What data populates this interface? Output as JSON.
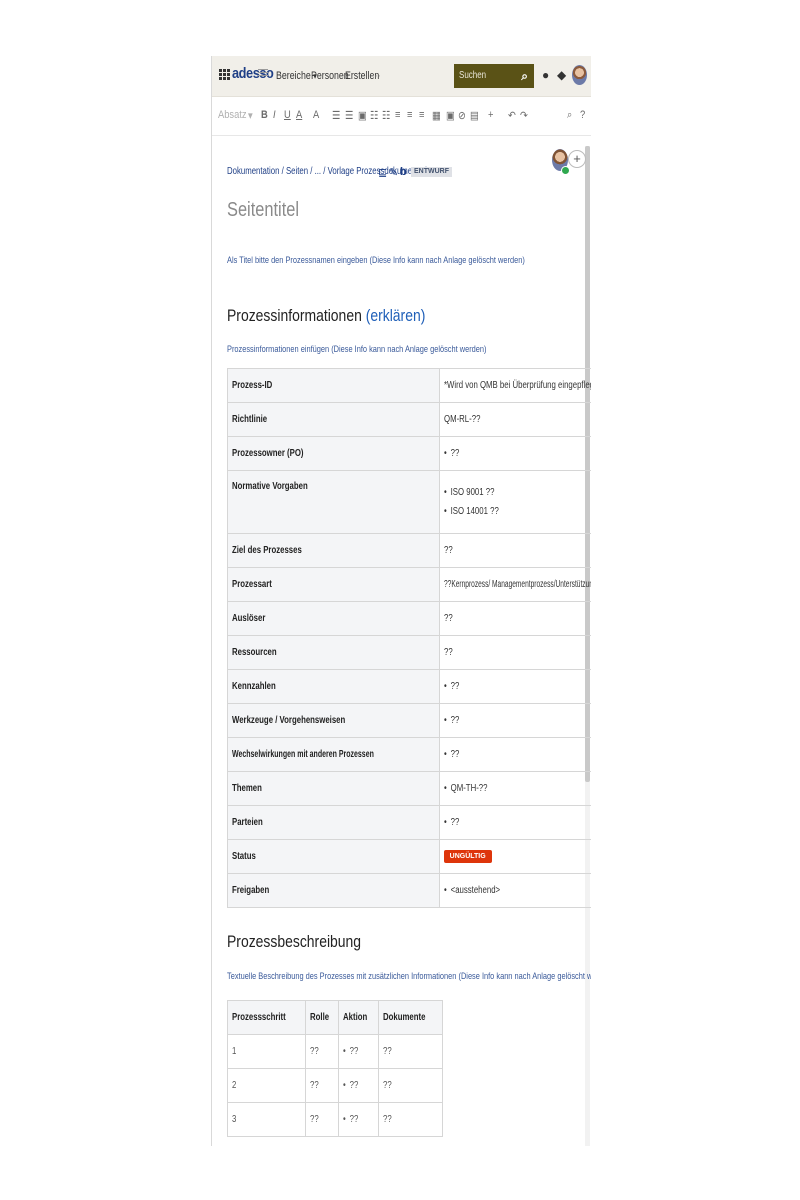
{
  "topbar": {
    "logo": "adesso",
    "nav": [
      {
        "label": "Bereiche",
        "chevron": "chevron-down-icon"
      },
      {
        "label": "Personen"
      },
      {
        "label": "Erstellen"
      },
      {
        "label": "···"
      }
    ],
    "search_placeholder": "Suchen",
    "icons": [
      "search-icon",
      "help-icon",
      "notification-icon",
      "avatar"
    ]
  },
  "toolbar": {
    "style_select": "Absatz",
    "buttons": [
      "B",
      "I",
      "U",
      "A",
      "A",
      "☰",
      "☰",
      "▣",
      "☷",
      "☷",
      "≡",
      "≡",
      "≡",
      "▦",
      "▣",
      "⊘",
      "▤",
      "+",
      "↶",
      "↷"
    ],
    "find_icon": "search-icon",
    "help_icon": "?"
  },
  "breadcrumb": "Dokumentation / Seiten / ... / Vorlage Prozessdokumentation",
  "draft_badge": "ENTWURF",
  "page_title": "Seitentitel",
  "title_hint": "Als Titel bitte den Prozessnamen eingeben (Diese Info kann nach Anlage gelöscht werden)",
  "section_info": {
    "heading": "Prozessinformationen ",
    "heading_link": "(erklären)",
    "hint": "Prozessinformationen einfügen (Diese Info kann nach Anlage gelöscht werden)"
  },
  "info_table": [
    {
      "key": "Prozess-ID",
      "value": "*Wird von QMB bei Überprüfung eingepflegt*"
    },
    {
      "key": "Richtlinie",
      "value": "QM-RL-??"
    },
    {
      "key": "Prozessowner (PO)",
      "bullets": [
        "??"
      ]
    },
    {
      "key": "Normative Vorgaben",
      "bullets": [
        "ISO 9001 ??",
        "ISO 14001 ??"
      ]
    },
    {
      "key": "Ziel des Prozesses",
      "value": "??"
    },
    {
      "key": "Prozessart",
      "value": "??Kernprozess/ Managementprozess/Unterstützungsprozess??"
    },
    {
      "key": "Auslöser",
      "value": "??"
    },
    {
      "key": "Ressourcen",
      "value": "??"
    },
    {
      "key": "Kennzahlen",
      "bullets": [
        "??"
      ]
    },
    {
      "key": "Werkzeuge / Vorgehensweisen",
      "bullets": [
        "??"
      ]
    },
    {
      "key": "Wechselwirkungen mit anderen Prozessen",
      "bullets": [
        "??"
      ]
    },
    {
      "key": "Themen",
      "bullets": [
        "QM-TH-??"
      ]
    },
    {
      "key": "Parteien",
      "bullets": [
        "??"
      ]
    },
    {
      "key": "Status",
      "tag": "UNGÜLTIG"
    },
    {
      "key": "Freigaben",
      "bullets": [
        "<ausstehend>"
      ]
    }
  ],
  "section_process": {
    "heading": "Prozessbeschreibung",
    "hint": "Textuelle Beschreibung des Prozesses mit zusätzlichen Informationen (Diese Info kann nach Anlage gelöscht werden)"
  },
  "process_table": {
    "headers": [
      "Prozessschritt",
      "Rolle",
      "Aktion",
      "Dokumente"
    ],
    "rows": [
      {
        "step": "1",
        "role": "??",
        "action": "??",
        "docs": "??"
      },
      {
        "step": "2",
        "role": "??",
        "action": "??",
        "docs": "??"
      },
      {
        "step": "3",
        "role": "??",
        "action": "??",
        "docs": "??"
      }
    ]
  },
  "colors": {
    "accent": "#1f3f86",
    "search_bg": "#5a5216",
    "status_tag": "#de350b",
    "topbar_bg": "#f1efe9"
  }
}
